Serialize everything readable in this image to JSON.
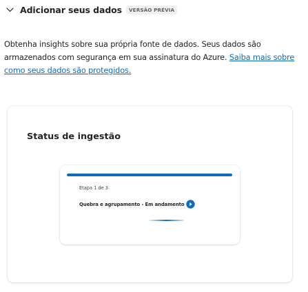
{
  "header": {
    "title": "Adicionar seus dados",
    "badge": "VERSÃO PRÉVIA",
    "chevron_icon": "chevron-down-icon"
  },
  "description": {
    "text": "Obtenha insights sobre sua própria fonte de dados. Seus dados são armazenados com segurança em sua assinatura do Azure. ",
    "link_text": "Saiba mais sobre como seus dados são protegidos."
  },
  "ingestion": {
    "title": "Status de ingestão",
    "step": "Etapa 1 de 3",
    "status": "Quebra e agrupamento - Em andamento",
    "status_icon": "play-circle-icon",
    "progress": 1.0,
    "accent_color": "#0f6cbd"
  }
}
